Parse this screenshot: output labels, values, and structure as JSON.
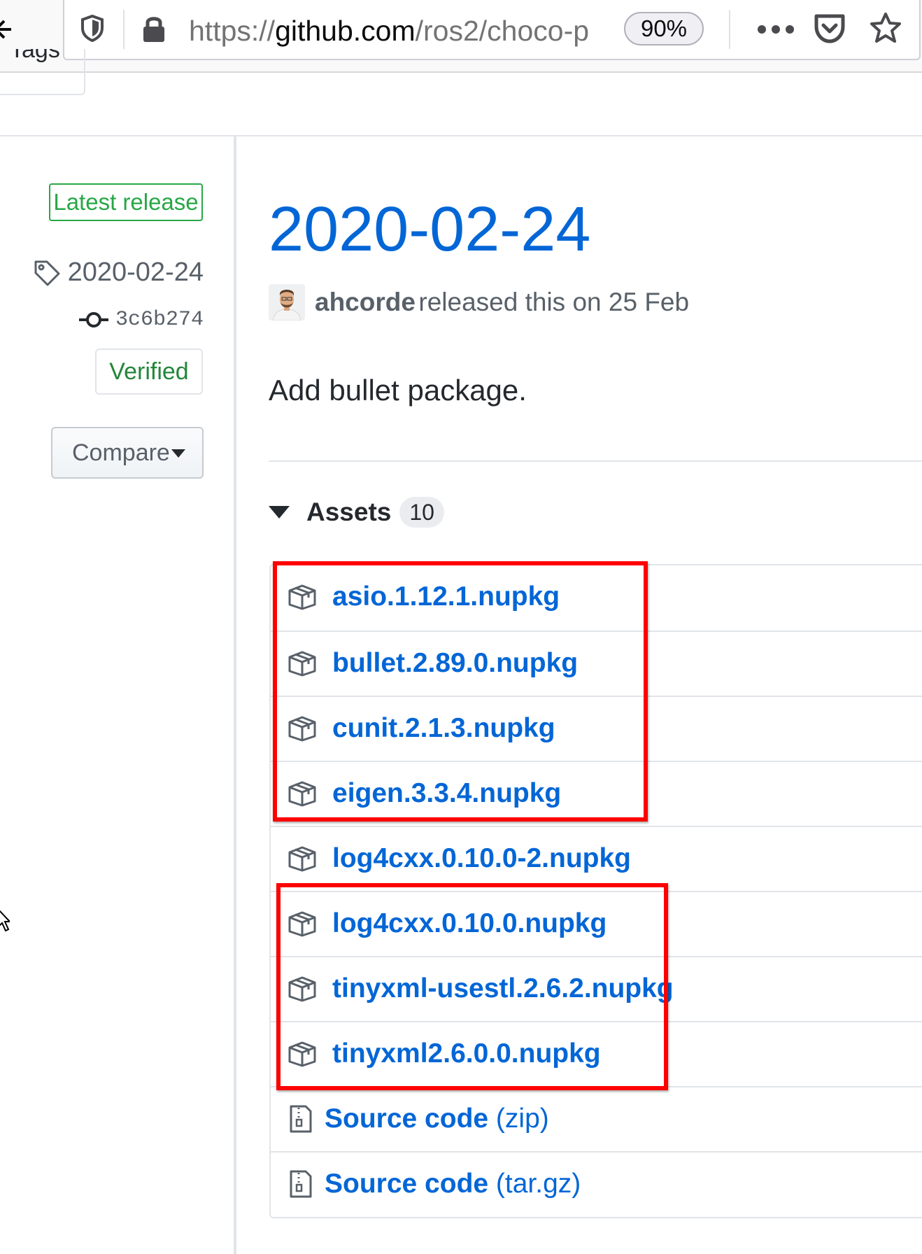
{
  "browser": {
    "url_prefix": "https://",
    "url_host": "github.com",
    "url_path": "/ros2/choco-p",
    "zoom": "90%"
  },
  "tabs": {
    "tags_label": "Tags"
  },
  "sidebar": {
    "latest_badge": "Latest release",
    "tag": "2020-02-24",
    "commit": "3c6b274",
    "verified": "Verified",
    "compare": "Compare"
  },
  "release": {
    "title": "2020-02-24",
    "author": "ahcorde",
    "byline": "released this on 25 Feb",
    "description": "Add bullet package."
  },
  "assets": {
    "label": "Assets",
    "count": "10",
    "packages": [
      "asio.1.12.1.nupkg",
      "bullet.2.89.0.nupkg",
      "cunit.2.1.3.nupkg",
      "eigen.3.3.4.nupkg",
      "log4cxx.0.10.0-2.nupkg",
      "log4cxx.0.10.0.nupkg",
      "tinyxml-usestl.2.6.2.nupkg",
      "tinyxml2.6.0.0.nupkg"
    ],
    "source": [
      {
        "label": "Source code",
        "suffix": "(zip)"
      },
      {
        "label": "Source code",
        "suffix": "(tar.gz)"
      }
    ]
  },
  "colors": {
    "link": "#0366d6",
    "highlight": "#ff0000",
    "verified": "#22863a",
    "latest": "#28a745"
  },
  "icons": [
    "back-arrow-icon",
    "shield-icon",
    "lock-icon",
    "more-icon",
    "pocket-icon",
    "bookmark-star-icon",
    "tag-icon",
    "commit-icon",
    "caret-down-icon",
    "triangle-down-icon",
    "package-icon",
    "file-zip-icon",
    "cursor-icon"
  ]
}
